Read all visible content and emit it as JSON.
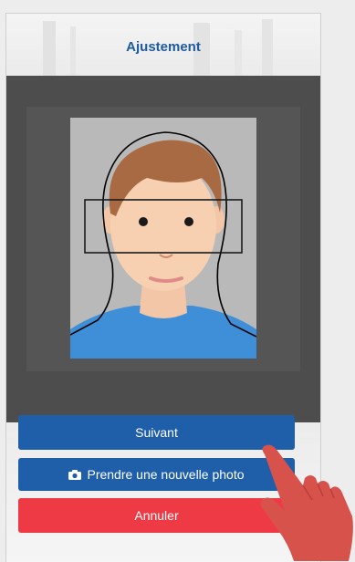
{
  "header": {
    "title": "Ajustement"
  },
  "buttons": {
    "next_label": "Suivant",
    "new_photo_label": "Prendre une nouvelle photo",
    "cancel_label": "Annuler"
  },
  "icons": {
    "camera": "camera-icon",
    "hand": "hand-pointer-icon"
  },
  "colors": {
    "primary": "#1f5ea8",
    "danger": "#ee3a45",
    "title": "#1e5aa0",
    "viewer_bg": "#4d4d4d",
    "photo_bg": "#b9b9b9",
    "shirt": "#3f8fd8",
    "hand": "#d8524c"
  }
}
